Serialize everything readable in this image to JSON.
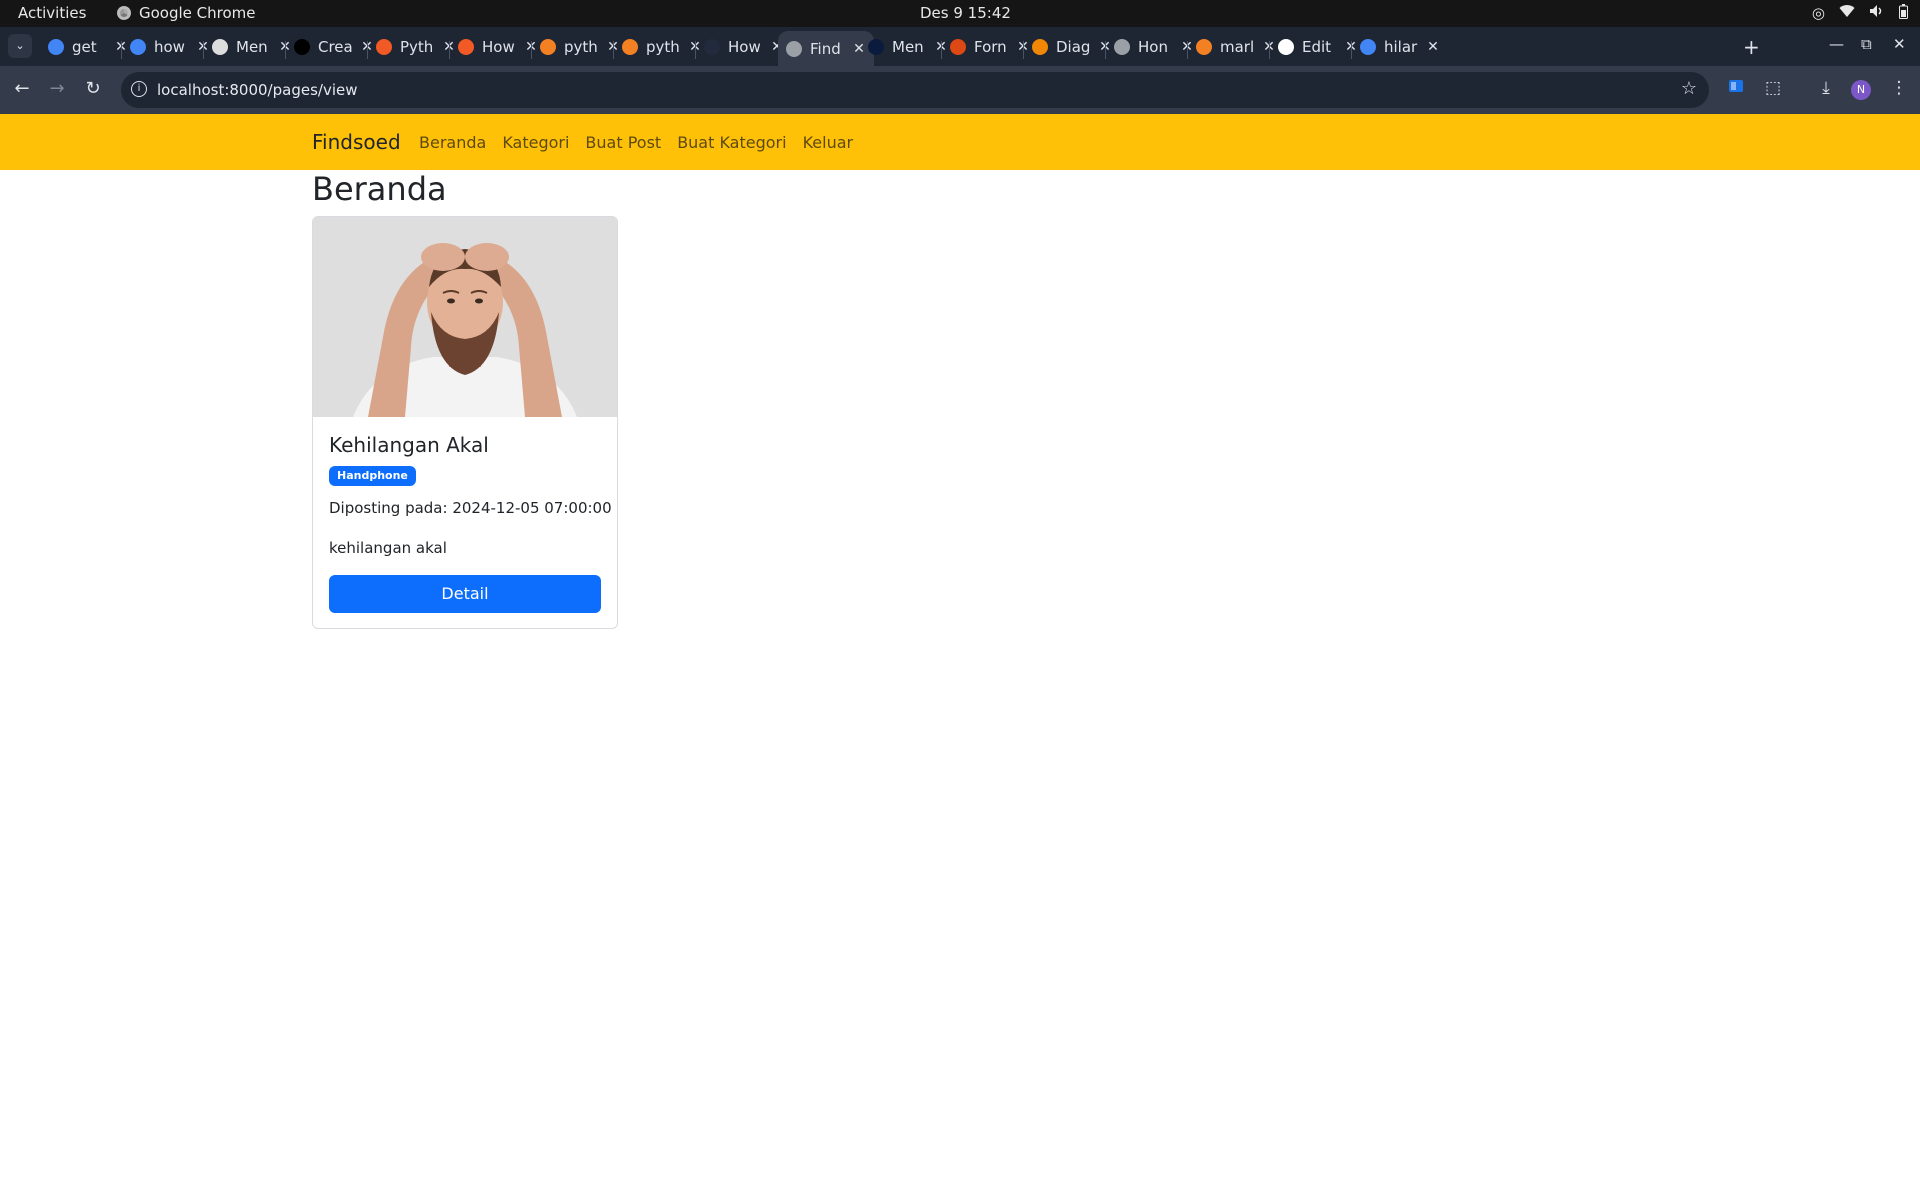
{
  "os": {
    "activities": "Activities",
    "app_name": "Google Chrome",
    "clock": "Des 9  15:42",
    "tray_icons": [
      "accessibility-icon",
      "wifi-icon",
      "volume-icon",
      "battery-icon"
    ]
  },
  "browser": {
    "tabs": [
      {
        "label": "get",
        "icon": "google-icon",
        "color": "#4285f4"
      },
      {
        "label": "how",
        "icon": "google-icon",
        "color": "#4285f4"
      },
      {
        "label": "Men",
        "icon": "openai-icon",
        "color": "#dddddd"
      },
      {
        "label": "Crea",
        "icon": "vercel-icon",
        "color": "#000000"
      },
      {
        "label": "Pyth",
        "icon": "stack-icon",
        "color": "#f15a24"
      },
      {
        "label": "How",
        "icon": "stack-icon",
        "color": "#f15a24"
      },
      {
        "label": "pyth",
        "icon": "stackoverflow-icon",
        "color": "#f48024"
      },
      {
        "label": "pyth",
        "icon": "stackoverflow-icon",
        "color": "#f48024"
      },
      {
        "label": "How",
        "icon": "astro-icon",
        "color": "#222a3d"
      },
      {
        "label": "Find",
        "icon": "globe-icon",
        "color": "#9aa0a6",
        "active": true
      },
      {
        "label": "Men",
        "icon": "meta-icon",
        "color": "#0a1b3d"
      },
      {
        "label": "Forn",
        "icon": "codeigniter-icon",
        "color": "#dd4814"
      },
      {
        "label": "Diag",
        "icon": "drawio-icon",
        "color": "#f08705"
      },
      {
        "label": "Hon",
        "icon": "globe-icon",
        "color": "#9aa0a6"
      },
      {
        "label": "marl",
        "icon": "stackoverflow-icon",
        "color": "#f48024"
      },
      {
        "label": "Edit",
        "icon": "github-icon",
        "color": "#ffffff"
      },
      {
        "label": "hilar",
        "icon": "google-icon",
        "color": "#4285f4"
      }
    ],
    "url": "localhost:8000/pages/view",
    "profile_initial": "N"
  },
  "site": {
    "brand": "Findsoed",
    "nav": [
      "Beranda",
      "Kategori",
      "Buat Post",
      "Buat Kategori",
      "Keluar"
    ],
    "page_title": "Beranda",
    "accent_color": "#ffc107",
    "posts": [
      {
        "title": "Kehilangan Akal",
        "category": "Handphone",
        "posted": "Diposting pada: 2024-12-05 07:00:00",
        "description": "kehilangan akal",
        "button": "Detail"
      }
    ]
  }
}
